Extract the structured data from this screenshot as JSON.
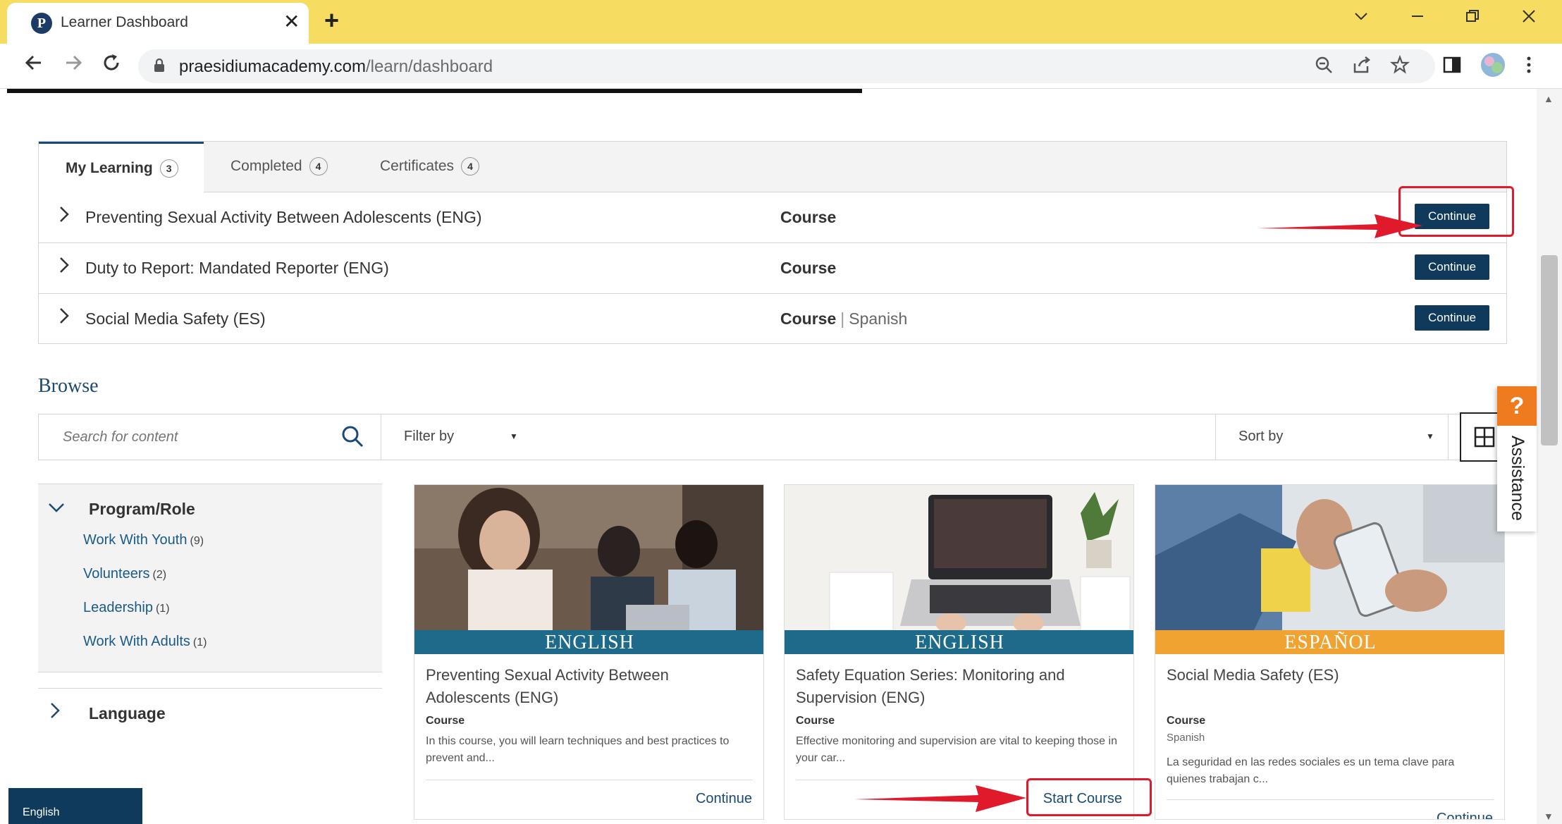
{
  "browser": {
    "tab_title": "Learner Dashboard",
    "favicon_letter": "P",
    "close_glyph": "✕",
    "new_tab_glyph": "+",
    "url_host": "praesidiumacademy.com",
    "url_path": "/learn/dashboard"
  },
  "tabs": [
    {
      "label": "My Learning",
      "count": "3"
    },
    {
      "label": "Completed",
      "count": "4"
    },
    {
      "label": "Certificates",
      "count": "4"
    }
  ],
  "learning_rows": [
    {
      "title": "Preventing Sexual Activity Between Adolescents (ENG)",
      "type": "Course",
      "language": "",
      "action": "Continue"
    },
    {
      "title": "Duty to Report: Mandated Reporter (ENG)",
      "type": "Course",
      "language": "",
      "action": "Continue"
    },
    {
      "title": "Social Media Safety (ES)",
      "type": "Course",
      "language": "Spanish",
      "action": "Continue"
    }
  ],
  "browse": {
    "title": "Browse",
    "search_placeholder": "Search for content",
    "filter_label": "Filter by",
    "sort_label": "Sort by"
  },
  "sidebar": {
    "section_title": "Program/Role",
    "items": [
      {
        "label": "Work With Youth",
        "count": "(9)"
      },
      {
        "label": "Volunteers",
        "count": "(2)"
      },
      {
        "label": "Leadership",
        "count": "(1)"
      },
      {
        "label": "Work With Adults",
        "count": "(1)"
      }
    ],
    "language_title": "Language"
  },
  "cards": [
    {
      "banner": "ENGLISH",
      "banner_color": "#1d6a8a",
      "title": "Preventing Sexual Activity Between Adolescents (ENG)",
      "type": "Course",
      "language": "",
      "description": "In this course, you will learn techniques and best practices to prevent and...",
      "action": "Continue"
    },
    {
      "banner": "ENGLISH",
      "banner_color": "#1d6a8a",
      "title": "Safety Equation Series: Monitoring and Supervision (ENG)",
      "type": "Course",
      "language": "",
      "description": "Effective monitoring and supervision are vital to keeping those in your car...",
      "action": "Start Course"
    },
    {
      "banner": "ESPAÑOL",
      "banner_color": "#f0a331",
      "title": "Social Media Safety (ES)",
      "type": "Course",
      "language": "Spanish",
      "description": "La seguridad en las redes sociales es un tema clave para quienes trabajan c...",
      "action": "Continue"
    }
  ],
  "assistance": {
    "icon": "?",
    "label": "Assistance"
  },
  "language_pill": "English",
  "colors": {
    "accent": "#0f3a5c",
    "highlight": "#e0192b",
    "tabbar": "#f7dc62"
  }
}
